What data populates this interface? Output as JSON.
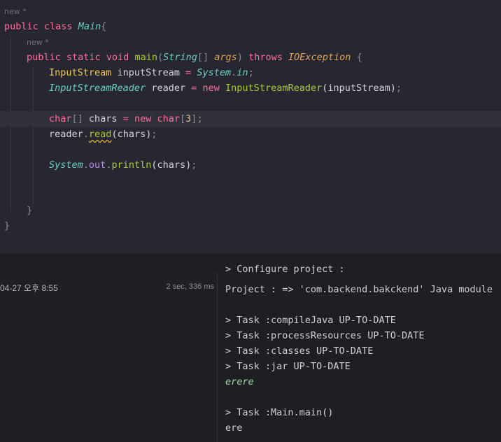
{
  "editor": {
    "hint_class": "new *",
    "hint_method": "new *",
    "lines": {
      "l1_kw": "public class",
      "l1_name": "Main",
      "l1_brace": "{",
      "l2_kw": "public static void",
      "l2_fn": "main",
      "l2_paren_open": "(",
      "l2_type": "String",
      "l2_arr": "[]",
      "l2_param": "args",
      "l2_paren_close": ")",
      "l2_throws": "throws",
      "l2_exc": "IOException",
      "l2_brace": "{",
      "l3_type": "InputStream",
      "l3_var": "inputStream",
      "l3_eq": "=",
      "l3_cls": "System",
      "l3_dot": ".",
      "l3_fld": "in",
      "l3_semi": ";",
      "l4_type": "InputStreamReader",
      "l4_var": "reader",
      "l4_eq": "=",
      "l4_new": "new",
      "l4_ctor": "InputStreamReader",
      "l4_args": "(inputStream)",
      "l4_semi": ";",
      "l6_type": "char",
      "l6_arr": "[]",
      "l6_var": "chars",
      "l6_eq": "=",
      "l6_new": "new",
      "l6_type2": "char",
      "l6_lb": "[",
      "l6_num": "3",
      "l6_rb": "];",
      "l7_obj": "reader",
      "l7_dot": ".",
      "l7_fn": "read",
      "l7_args": "(chars)",
      "l7_semi": ";",
      "l9_cls": "System",
      "l9_dot1": ".",
      "l9_fld": "out",
      "l9_dot2": ".",
      "l9_fn": "println",
      "l9_args": "(chars)",
      "l9_semi": ";",
      "l12_close": "}",
      "l13_close": "}"
    }
  },
  "run_panel": {
    "date": "04-27 오후 8:55",
    "duration": "2 sec, 336 ms",
    "output": [
      "> Configure project :",
      "Project : => 'com.backend.bakckend' Java module",
      "",
      "> Task :compileJava UP-TO-DATE",
      "> Task :processResources UP-TO-DATE",
      "> Task :classes UP-TO-DATE",
      "> Task :jar UP-TO-DATE",
      "erere",
      "",
      "> Task :Main.main()",
      "ere"
    ]
  }
}
